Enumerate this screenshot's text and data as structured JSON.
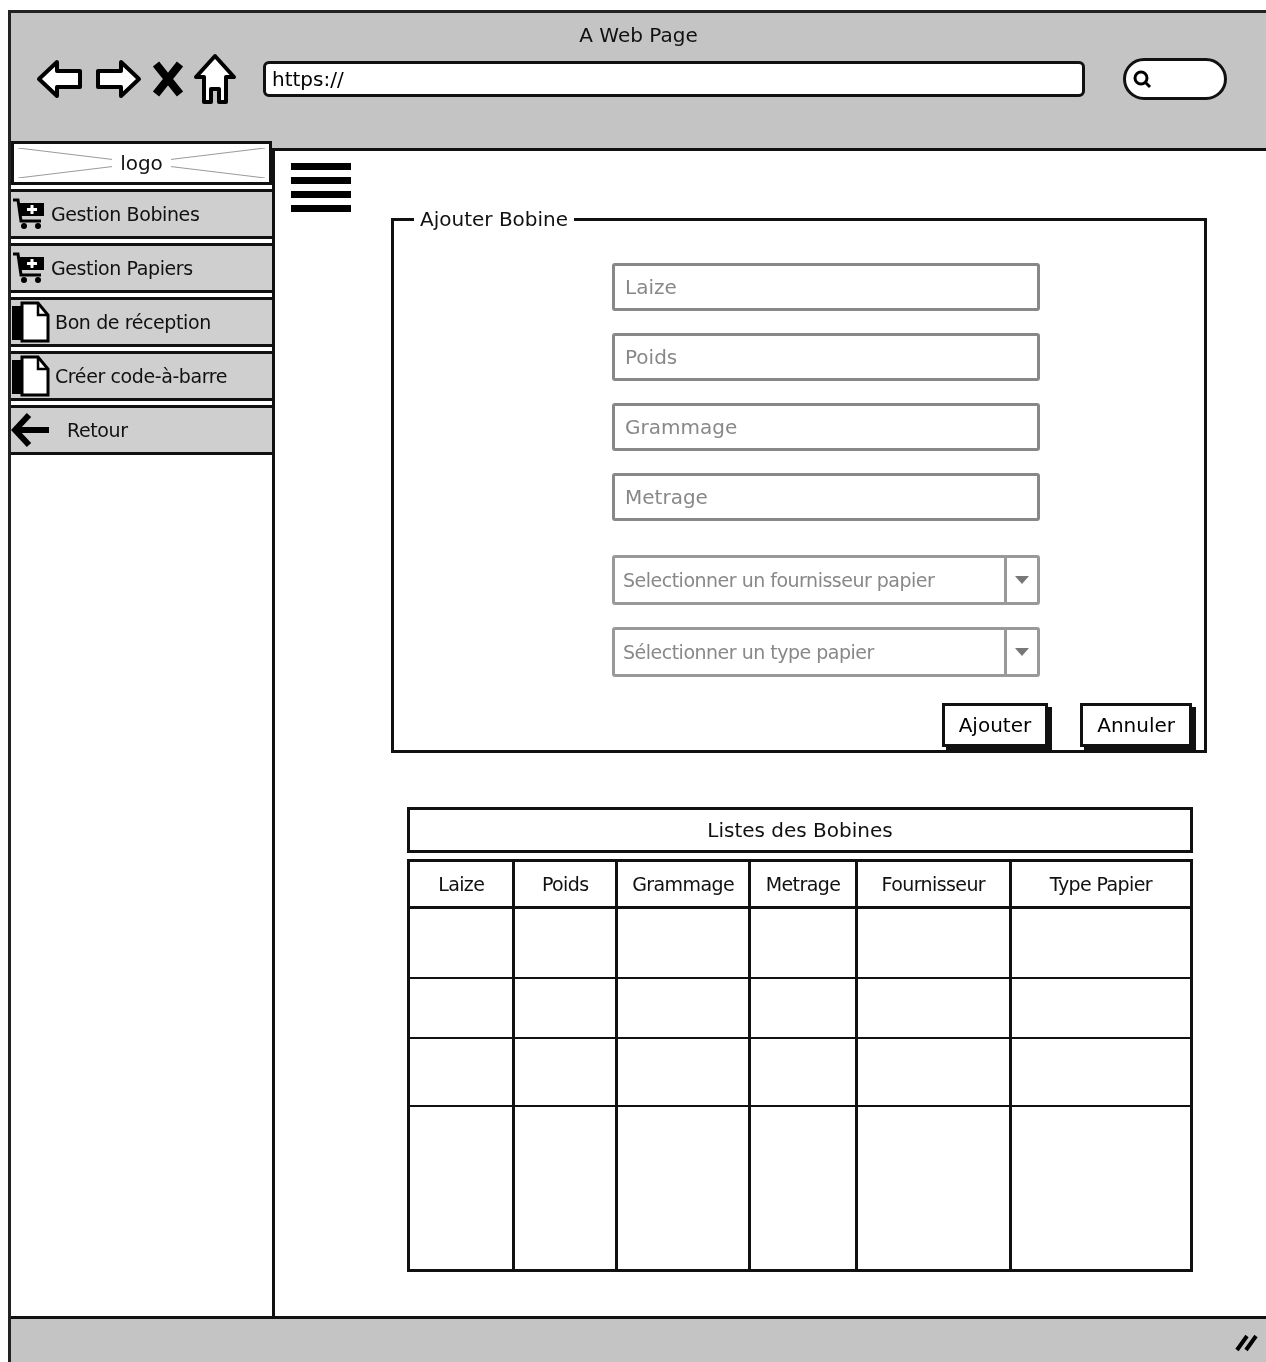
{
  "window": {
    "title": "A Web Page"
  },
  "address_bar": {
    "value": "https://"
  },
  "sidebar": {
    "logo": "logo",
    "items": [
      {
        "label": "Gestion Bobines",
        "kind": "cart"
      },
      {
        "label": "Gestion Papiers",
        "kind": "cart"
      },
      {
        "label": "Bon de réception",
        "kind": "document"
      },
      {
        "label": "Créer code-à-barre",
        "kind": "document"
      },
      {
        "label": "Retour",
        "kind": "back"
      }
    ]
  },
  "form": {
    "title": "Ajouter Bobine",
    "fields": [
      {
        "placeholder": "Laize",
        "kind": "text"
      },
      {
        "placeholder": "Poids",
        "kind": "text"
      },
      {
        "placeholder": "Grammage",
        "kind": "text"
      },
      {
        "placeholder": "Metrage",
        "kind": "text"
      },
      {
        "placeholder": "Selectionner un fournisseur papier",
        "kind": "select"
      },
      {
        "placeholder": "Sélectionner un type papier",
        "kind": "select"
      }
    ],
    "buttons": [
      "Ajouter",
      "Annuler"
    ]
  },
  "table": {
    "title": "Listes des Bobines",
    "columns": [
      "Laize",
      "Poids",
      "Grammage",
      "Metrage",
      "Fournisseur",
      "Type Papier"
    ]
  }
}
